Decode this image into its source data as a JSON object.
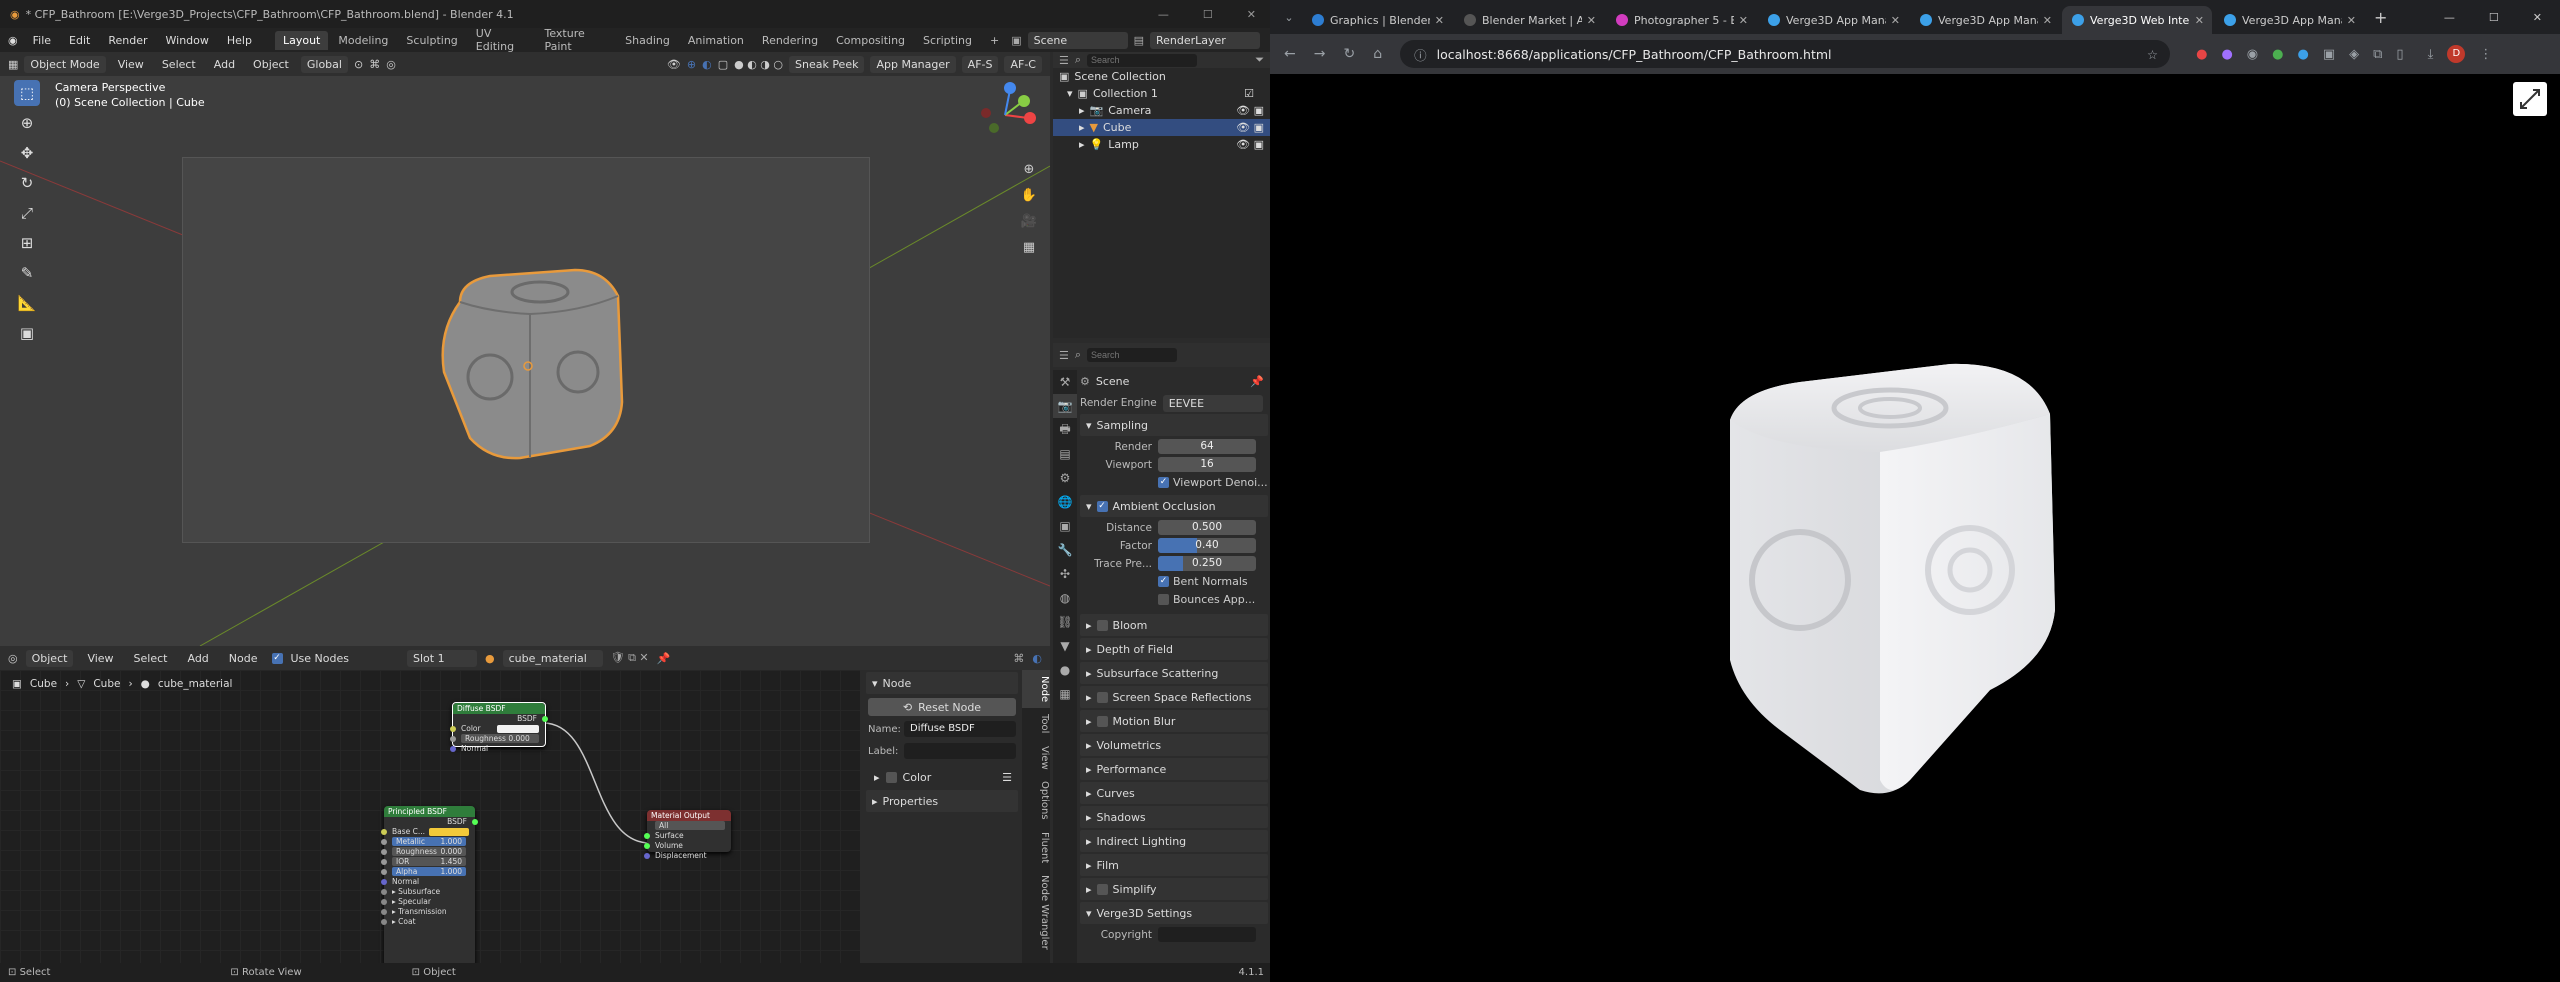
{
  "blender": {
    "title": "* CFP_Bathroom [E:\\Verge3D_Projects\\CFP_Bathroom\\CFP_Bathroom.blend] - Blender 4.1",
    "menu": [
      "File",
      "Edit",
      "Render",
      "Window",
      "Help"
    ],
    "workspaces": [
      "Layout",
      "Modeling",
      "Sculpting",
      "UV Editing",
      "Texture Paint",
      "Shading",
      "Animation",
      "Rendering",
      "Compositing",
      "Scripting"
    ],
    "active_workspace": "Layout",
    "scene_name": "Scene",
    "render_layer": "RenderLayer",
    "viewport_header": {
      "mode": "Object Mode",
      "menus": [
        "View",
        "Select",
        "Add",
        "Object"
      ],
      "transform": "Global",
      "sneak_peek": "Sneak Peek",
      "app_manager": "App Manager",
      "afs": "AF-S",
      "afc": "AF-C"
    },
    "viewport_info": {
      "line1": "Camera Perspective",
      "line2": "(0) Scene Collection | Cube"
    },
    "outliner": {
      "search_placeholder": "Search",
      "root": "Scene Collection",
      "collection": "Collection 1",
      "items": [
        "Camera",
        "Cube",
        "Lamp"
      ],
      "selected": "Cube"
    },
    "properties": {
      "search_placeholder": "Search",
      "scene": "Scene",
      "render_engine_label": "Render Engine",
      "render_engine": "EEVEE",
      "sampling": "Sampling",
      "render_label": "Render",
      "render_samples": "64",
      "viewport_label": "Viewport",
      "viewport_samples": "16",
      "viewport_denoise": "Viewport Denoi...",
      "ao": "Ambient Occlusion",
      "distance_label": "Distance",
      "distance": "0.500",
      "factor_label": "Factor",
      "factor": "0.40",
      "factor_fraction": 0.4,
      "trace_label": "Trace Pre...",
      "trace": "0.250",
      "trace_fraction": 0.25,
      "bent_normals": "Bent Normals",
      "bounces": "Bounces App...",
      "panels": [
        "Bloom",
        "Depth of Field",
        "Subsurface Scattering",
        "Screen Space Reflections",
        "Motion Blur",
        "Volumetrics",
        "Performance",
        "Curves",
        "Shadows",
        "Indirect Lighting",
        "Film",
        "Simplify",
        "Verge3D Settings"
      ],
      "panels_with_checkbox": [
        "Bloom",
        "Screen Space Reflections",
        "Motion Blur",
        "Simplify"
      ],
      "copyright_label": "Copyright"
    },
    "node_header": {
      "type": "Object",
      "menus": [
        "View",
        "Select",
        "Add",
        "Node"
      ],
      "use_nodes": "Use Nodes",
      "slot": "Slot 1",
      "material": "cube_material"
    },
    "breadcrumb": [
      "Cube",
      "Cube",
      "cube_material"
    ],
    "nodes": {
      "diffuse": {
        "title": "Diffuse BSDF",
        "out": "BSDF",
        "color": "Color",
        "roughness": "Roughness",
        "roughness_val": "0.000",
        "normal": "Normal"
      },
      "principled": {
        "title": "Principled BSDF",
        "out": "BSDF",
        "rows": [
          "Base C...",
          "Metallic",
          "Roughness",
          "IOR",
          "Alpha",
          "Normal",
          "Subsurface",
          "Specular",
          "Transmission",
          "Coat"
        ],
        "values": [
          "",
          "1.000",
          "0.000",
          "1.450",
          "1.000"
        ]
      },
      "output": {
        "title": "Material Output",
        "target": "All",
        "rows": [
          "Surface",
          "Volume",
          "Displacement"
        ]
      }
    },
    "node_sidebar": {
      "panel": "Node",
      "reset": "Reset Node",
      "name_label": "Name:",
      "name": "Diffuse BSDF",
      "label_label": "Label:",
      "color": "Color",
      "properties": "Properties",
      "tabs": [
        "Node",
        "Tool",
        "View",
        "Options",
        "Fluent",
        "Node Wrangler"
      ]
    },
    "status": {
      "select": "Select",
      "rotate": "Rotate View",
      "object": "Object",
      "version": "4.1.1"
    },
    "colors": {
      "accent": "#4772b3",
      "selection": "#e89a3c",
      "diffuse_header": "#2f7d3b",
      "principled_header": "#2f7d3b",
      "output_header": "#7d3030"
    }
  },
  "chrome": {
    "tabs": [
      {
        "title": "Graphics | Blender",
        "favicon": "#2d7dd2"
      },
      {
        "title": "Blender Market | A...",
        "favicon": "#555"
      },
      {
        "title": "Photographer 5 - Bl...",
        "favicon": "#d23cbf"
      },
      {
        "title": "Verge3D App Mana...",
        "favicon": "#3ca0e8"
      },
      {
        "title": "Verge3D App Mana...",
        "favicon": "#3ca0e8"
      },
      {
        "title": "Verge3D Web Interac...",
        "favicon": "#3ca0e8"
      },
      {
        "title": "Verge3D App Mana...",
        "favicon": "#3ca0e8"
      }
    ],
    "active_tab": 5,
    "url": "localhost:8668/applications/CFP_Bathroom/CFP_Bathroom.html"
  }
}
